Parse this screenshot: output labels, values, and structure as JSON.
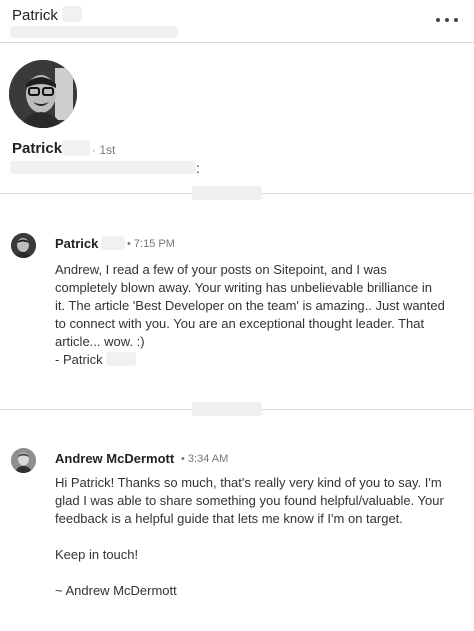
{
  "header": {
    "name": "Patrick"
  },
  "profile": {
    "name": "Patrick",
    "degree": "· 1st",
    "headline_suffix": ":"
  },
  "messages": [
    {
      "sender": "Patrick",
      "time": "• 7:15 PM",
      "lines": [
        "Andrew, I read a few of your posts on Sitepoint, and I was",
        "completely blown away. Your writing has unbelievable brilliance in",
        "it. The article 'Best Developer on the team' is amazing.. Just wanted",
        "to connect with you. You are an exceptional thought leader. That",
        "article... wow. :)",
        "- Patrick"
      ]
    },
    {
      "sender": "Andrew McDermott",
      "time": "• 3:34 AM",
      "lines": [
        "Hi Patrick! Thanks so much, that's really very kind of you to say. I'm",
        "glad I was able to share something you found helpful/valuable. Your",
        "feedback is a helpful guide that lets me know if I'm on target.",
        "",
        "Keep in touch!",
        "",
        "~ Andrew McDermott"
      ]
    }
  ]
}
